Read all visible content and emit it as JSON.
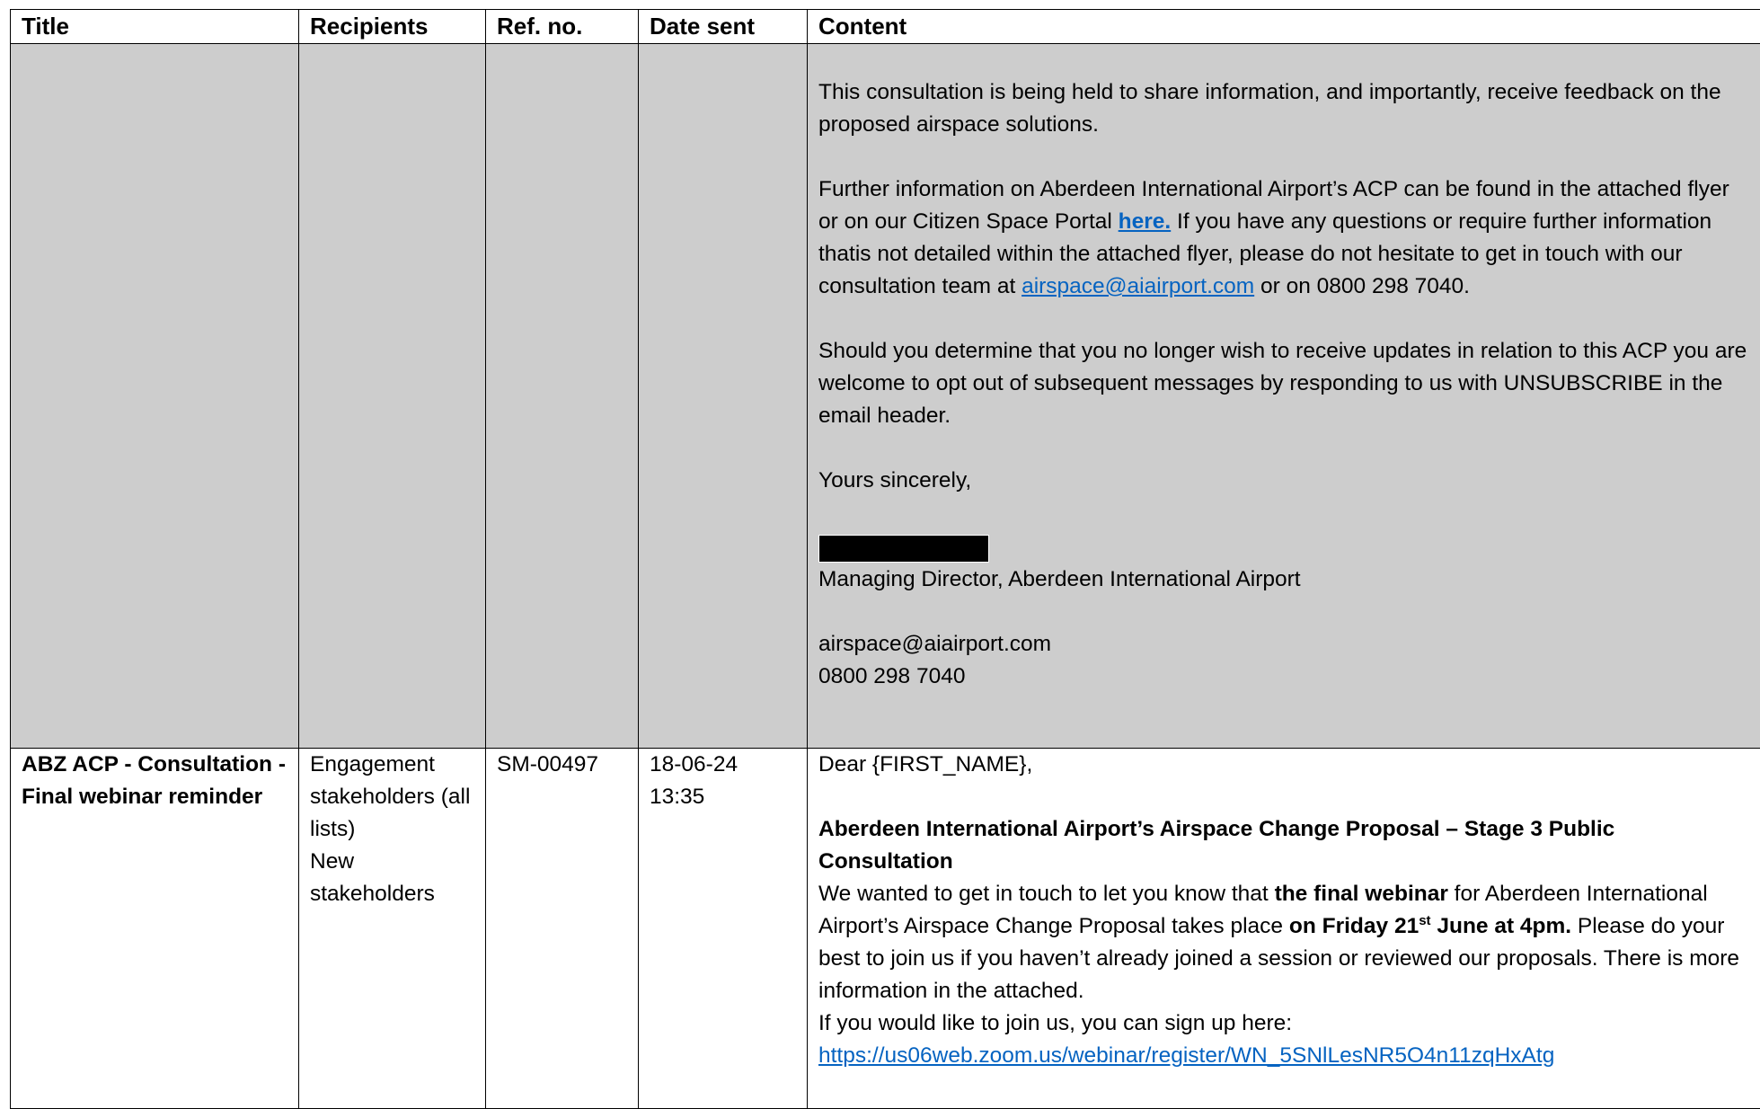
{
  "headers": {
    "title": "Title",
    "recipients": "Recipients",
    "ref": "Ref. no.",
    "date": "Date sent",
    "content": "Content"
  },
  "row1": {
    "p1": "This consultation is being held to share information, and importantly, receive feedback on the proposed airspace solutions.",
    "p2_a": "Further information on Aberdeen International Airport’s ACP can be found in the attached flyer or on our Citizen Space Portal ",
    "p2_link": "here.",
    "p2_b": " If you have any questions or require further information thatis not detailed within the attached flyer, please do not hesitate to get in touch with our consultation team at ",
    "p2_email": "airspace@aiairport.com",
    "p2_c": " or on 0800 298 7040.",
    "p3": "Should you determine that you no longer wish to receive updates in relation to this ACP you are welcome to opt out of subsequent messages by responding to us with UNSUBSCRIBE in the email header.",
    "closing": "Yours sincerely,",
    "role": "Managing Director, Aberdeen International Airport",
    "email": "airspace@aiairport.com",
    "phone": "0800 298 7040"
  },
  "row2": {
    "title": "ABZ ACP - Consultation - Final webinar reminder",
    "recipients_1": "Engagement stakeholders (all lists)",
    "recipients_2": "New stakeholders",
    "ref": "SM-00497",
    "date": "18-06-24",
    "time": "13:35",
    "greeting": "Dear {FIRST_NAME},",
    "heading": "Aberdeen International Airport’s Airspace Change Proposal – Stage 3 Public Consultation",
    "body_a": "We wanted to get in touch to let you know that ",
    "body_b": "the final webinar",
    "body_c": " for Aberdeen International Airport’s Airspace Change Proposal takes place ",
    "body_d": "on Friday 21",
    "body_sup": "st",
    "body_e": " June at 4pm.",
    "body_f": " Please do your best to join us if you haven’t already joined a session or reviewed our proposals. There is more information in the attached.",
    "signup": "If you would like to join us, you can sign up here:",
    "signup_link": "https://us06web.zoom.us/webinar/register/WN_5SNlLesNR5O4n11zqHxAtg"
  }
}
